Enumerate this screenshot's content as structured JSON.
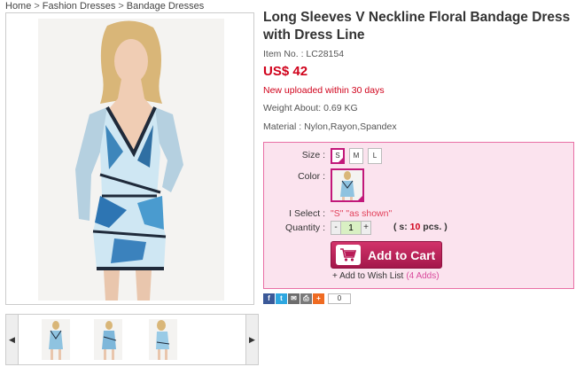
{
  "breadcrumb": {
    "items": [
      "Home",
      "Fashion Dresses",
      "Bandage Dresses"
    ],
    "separator": ">"
  },
  "product": {
    "title": "Long Sleeves V Neckline Floral Bandage Dress with Dress Line",
    "item_no": "Item No. : LC28154",
    "price": "US$ 42",
    "new_upload": "New uploaded within 30 days",
    "weight": "Weight About: 0.69 KG",
    "material": "Material : Nylon,Rayon,Spandex"
  },
  "options": {
    "size_label": "Size :",
    "sizes": [
      "S",
      "M",
      "L"
    ],
    "selected_size": "S",
    "color_label": "Color :",
    "iselect_label": "I Select :",
    "iselect_value": "\"S\" \"as shown\"",
    "quantity_label": "Quantity :",
    "qty_minus": "-",
    "qty_value": "1",
    "qty_plus": "+",
    "stock_prefix": "( s:",
    "stock_num": "10",
    "stock_suffix": "pcs. )",
    "add_to_cart": "Add to Cart",
    "wishlist": "+ Add to Wish List",
    "wishlist_adds": "(4 Adds)"
  },
  "share": {
    "count": "0",
    "icons": [
      "facebook-icon",
      "twitter-icon",
      "mail-icon",
      "print-icon",
      "plus-icon"
    ]
  },
  "thumbs": {
    "prev": "◀",
    "next": "▶"
  },
  "colors": {
    "accent": "#c2187a",
    "price": "#d0021b",
    "panel_bg": "#fbe3ee",
    "panel_border": "#e96fa5"
  }
}
